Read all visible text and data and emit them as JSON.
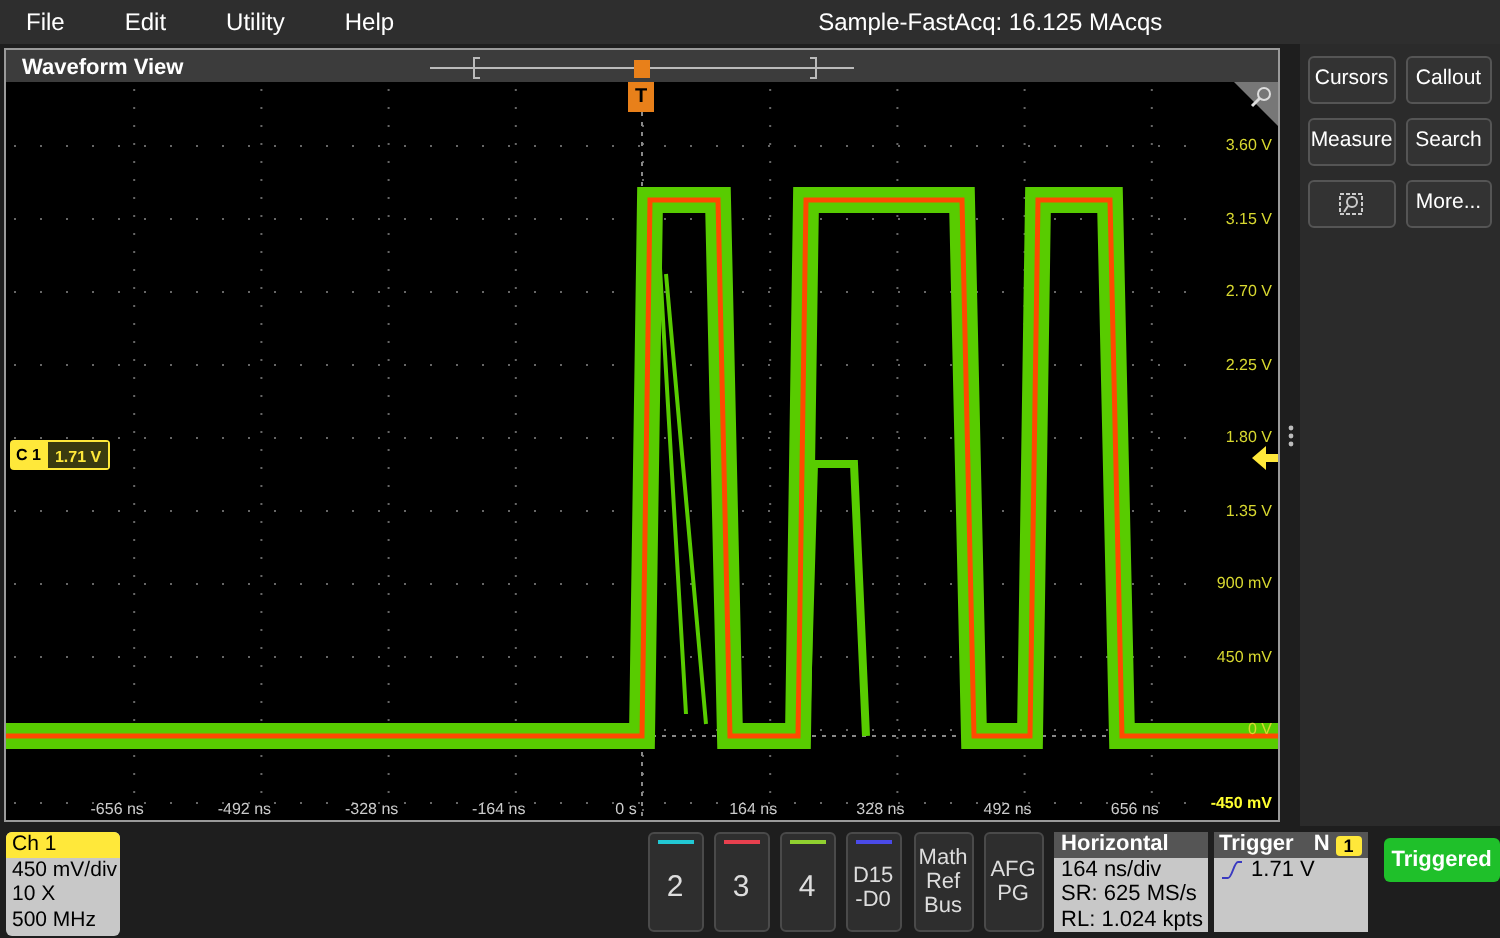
{
  "menu": [
    "File",
    "Edit",
    "Utility",
    "Help"
  ],
  "acquisition_status": "Sample-FastAcq: 16.125 MAcqs",
  "waveform_view": {
    "title": "Waveform View",
    "trigger_marker": "T",
    "channel_badge": {
      "label": "C 1",
      "value": "1.71 V"
    },
    "y_labels": [
      "3.60 V",
      "3.15 V",
      "2.70 V",
      "2.25 V",
      "1.80 V",
      "1.35 V",
      "900 mV",
      "450 mV",
      "0 V",
      "-450 mV"
    ],
    "x_labels": [
      "-656 ns",
      "-492 ns",
      "-328 ns",
      "-164 ns",
      "0 s",
      "164 ns",
      "328 ns",
      "492 ns",
      "656 ns"
    ]
  },
  "side_buttons": [
    {
      "kind": "text",
      "label": "Cursors"
    },
    {
      "kind": "text",
      "label": "Callout"
    },
    {
      "kind": "text",
      "label": "Measure"
    },
    {
      "kind": "text",
      "label": "Search"
    },
    {
      "kind": "icon"
    },
    {
      "kind": "text",
      "label": "More..."
    }
  ],
  "channel_1": {
    "title": "Ch 1",
    "lines": [
      "450 mV/div",
      "10 X",
      "500 MHz"
    ]
  },
  "channel_buttons": [
    {
      "lines": [
        "2"
      ],
      "color": "#22c8d4"
    },
    {
      "lines": [
        "3"
      ],
      "color": "#e8404e"
    },
    {
      "lines": [
        "4"
      ],
      "color": "#90d030"
    },
    {
      "lines": [
        "D15",
        "-D0"
      ],
      "color": "#4a4ae8"
    }
  ],
  "extra_buttons": [
    {
      "lines": [
        "Math",
        "Ref",
        "Bus"
      ]
    },
    {
      "lines": [
        "AFG",
        "PG"
      ]
    }
  ],
  "horizontal": {
    "title": "Horizontal",
    "lines": [
      "164 ns/div",
      "SR: 625 MS/s",
      "RL: 1.024 kpts"
    ]
  },
  "trigger": {
    "title": "Trigger",
    "mode": "N",
    "source": "1",
    "level": "1.71 V"
  },
  "status_button": "Triggered"
}
